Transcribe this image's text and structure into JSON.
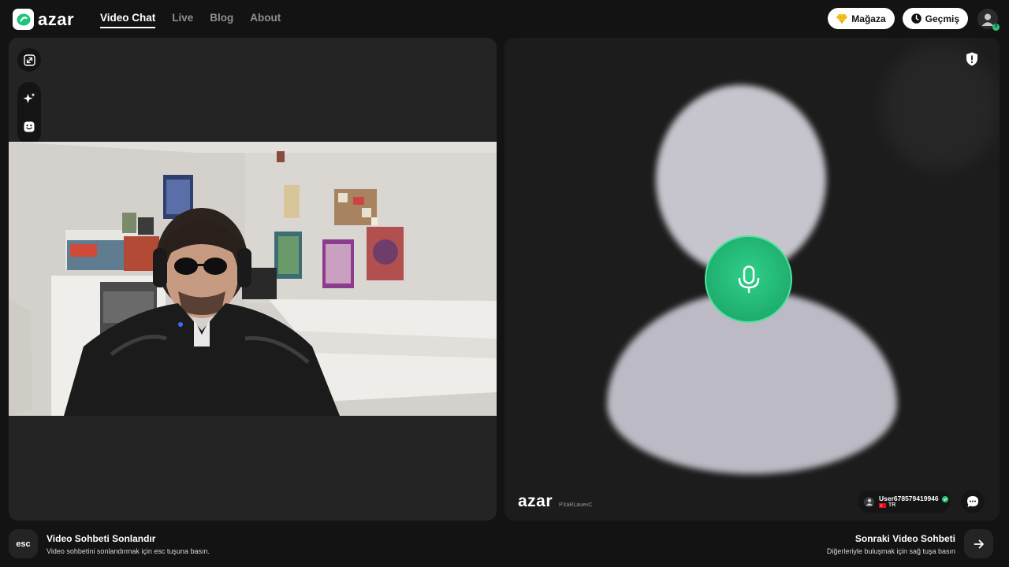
{
  "brand": {
    "name": "azar"
  },
  "nav": {
    "items": [
      {
        "label": "Video Chat",
        "active": true
      },
      {
        "label": "Live",
        "active": false
      },
      {
        "label": "Blog",
        "active": false
      },
      {
        "label": "About",
        "active": false
      }
    ]
  },
  "header": {
    "shop_label": "Mağaza",
    "history_label": "Geçmiş",
    "avatar_badge": "0"
  },
  "partner": {
    "watermark_logo": "azar",
    "watermark_id": "PXaRLauevC",
    "username": "User678579419946",
    "country": "TR"
  },
  "footer": {
    "esc_key": "esc",
    "end_title": "Video Sohbeti Sonlandır",
    "end_hint": "Video sohbetini sonlandırmak için esc tuşuna basın.",
    "next_title": "Sonraki Video Sohbeti",
    "next_hint": "Diğerleriyle buluşmak için sağ tuşa basın"
  },
  "colors": {
    "accent_green": "#1fae6e",
    "background": "#131313",
    "panel": "#242424",
    "shop_icon": "#f6c52b"
  },
  "icons": {
    "expand": "expand-icon",
    "effects": "sparkle-icon",
    "sticker": "smiley-icon",
    "report": "shield-alert-icon",
    "mic": "microphone-icon",
    "chat": "chat-bubble-icon",
    "next": "arrow-right-icon"
  }
}
